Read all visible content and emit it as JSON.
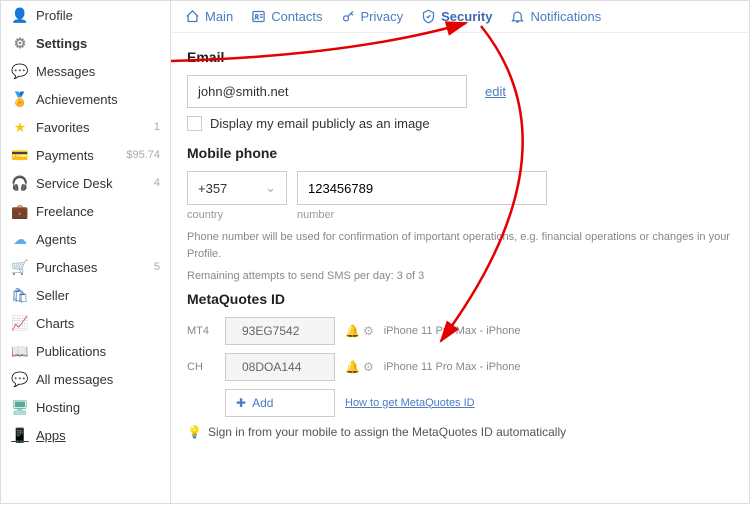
{
  "sidebar": {
    "items": [
      {
        "label": "Profile",
        "icon": "👤",
        "color": "#6a7a8a"
      },
      {
        "label": "Settings",
        "icon": "⚙",
        "color": "#888",
        "active": true
      },
      {
        "label": "Messages",
        "icon": "💬",
        "color": "#3b8ae6"
      },
      {
        "label": "Achievements",
        "icon": "🏅",
        "color": "#e6a23c"
      },
      {
        "label": "Favorites",
        "icon": "★",
        "color": "#f5c518",
        "badge": "1"
      },
      {
        "label": "Payments",
        "icon": "💳",
        "color": "#888",
        "badge": "$95.74"
      },
      {
        "label": "Service Desk",
        "icon": "🎧",
        "color": "#555",
        "badge": "4"
      },
      {
        "label": "Freelance",
        "icon": "💼",
        "color": "#e67e22"
      },
      {
        "label": "Agents",
        "icon": "☁",
        "color": "#5bb0e8"
      },
      {
        "label": "Purchases",
        "icon": "🛒",
        "color": "#888",
        "badge": "5"
      },
      {
        "label": "Seller",
        "icon": "🛍",
        "color": "#3b6bb0"
      },
      {
        "label": "Charts",
        "icon": "📈",
        "color": "#d66"
      },
      {
        "label": "Publications",
        "icon": "📖",
        "color": "#999"
      },
      {
        "label": "All messages",
        "icon": "💬",
        "color": "#3b8ae6"
      },
      {
        "label": "Hosting",
        "icon": "🖥",
        "color": "#5a9"
      },
      {
        "label": "Apps",
        "icon": "📱",
        "color": "#888",
        "underline": true
      }
    ]
  },
  "tabs": [
    {
      "label": "Main",
      "icon": "home"
    },
    {
      "label": "Contacts",
      "icon": "contacts"
    },
    {
      "label": "Privacy",
      "icon": "key"
    },
    {
      "label": "Security",
      "icon": "shield",
      "active": true
    },
    {
      "label": "Notifications",
      "icon": "bell"
    }
  ],
  "sections": {
    "email": {
      "heading": "Email",
      "value": "john@smith.net",
      "edit": "edit",
      "checkbox_label": "Display my email publicly as an image"
    },
    "phone": {
      "heading": "Mobile phone",
      "country": "+357",
      "number": "123456789",
      "country_label": "country",
      "number_label": "number",
      "help1": "Phone number will be used for confirmation of important operations, e.g. financial operations or changes in your Profile.",
      "help2": "Remaining attempts to send SMS per day: 3 of 3"
    },
    "mqid": {
      "heading": "MetaQuotes ID",
      "rows": [
        {
          "label": "MT4",
          "code": "93EG7542",
          "device": "iPhone 11 Pro Max - iPhone"
        },
        {
          "label": "CH",
          "code": "08DOA144",
          "device": "iPhone 11 Pro Max - iPhone"
        }
      ],
      "add": "Add",
      "how_link": "How to get MetaQuotes ID",
      "tip": "Sign in from your mobile to assign the MetaQuotes ID automatically"
    }
  }
}
